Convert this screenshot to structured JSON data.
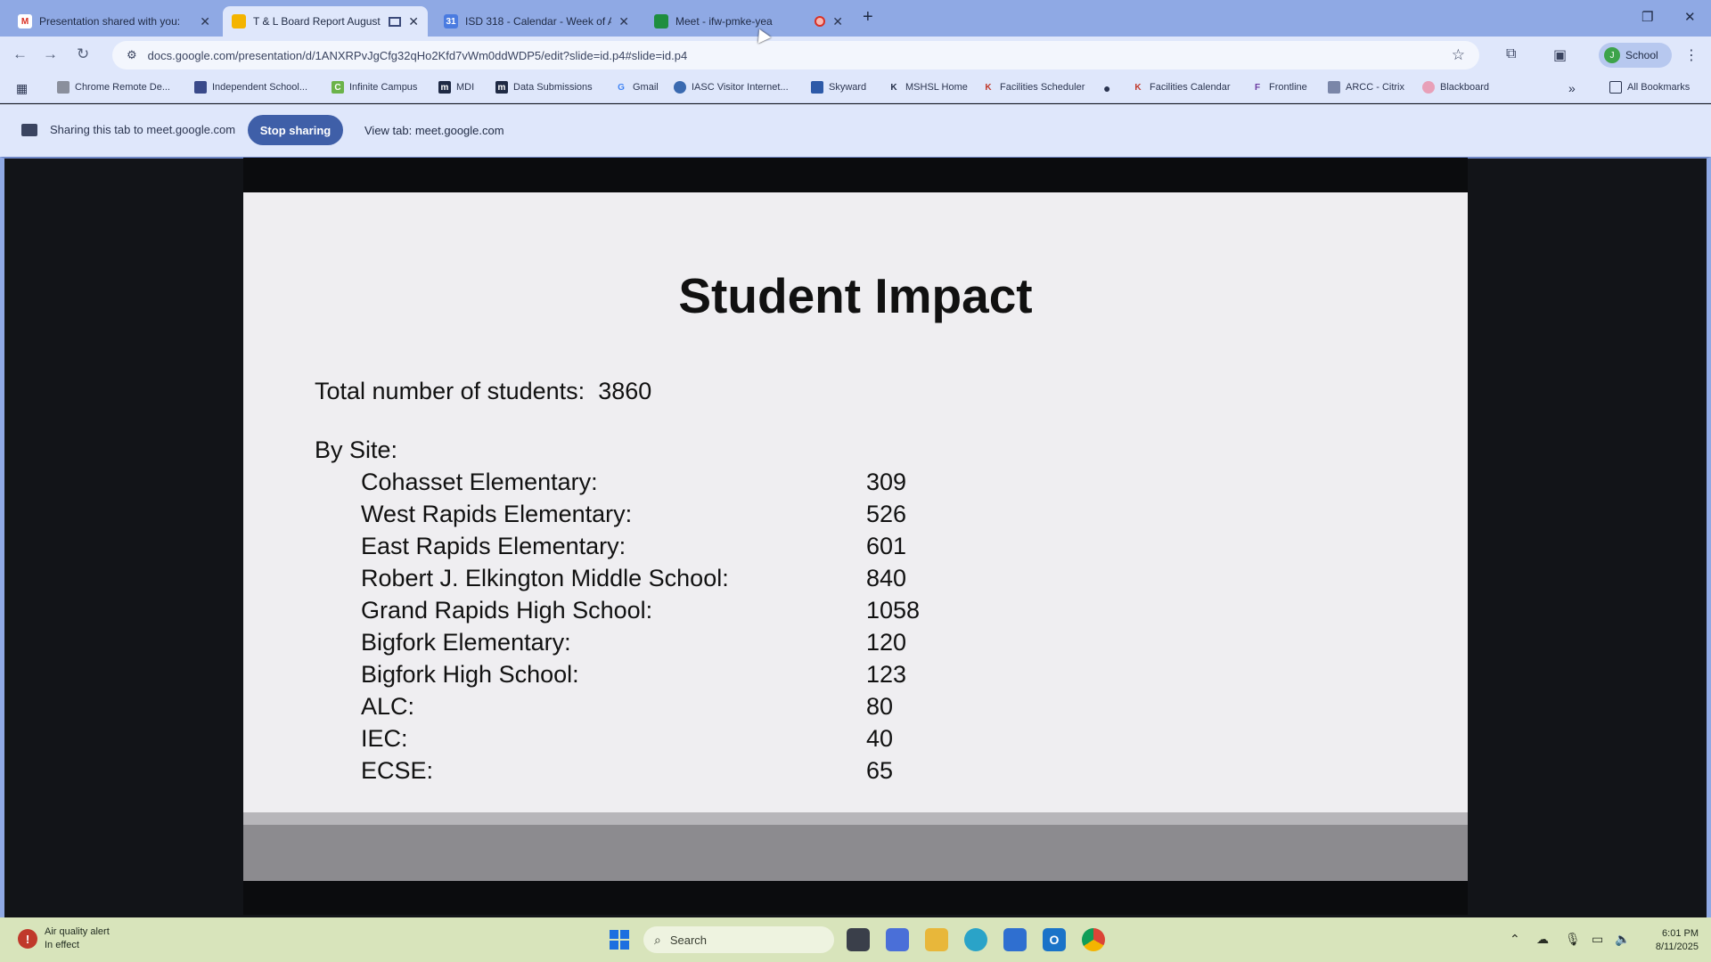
{
  "browser": {
    "tabs": [
      {
        "title": "Presentation shared with you:",
        "icon": "gmail-icon"
      },
      {
        "title": "T & L Board Report August",
        "icon": "slides-icon"
      },
      {
        "title": "ISD 318 - Calendar - Week of A",
        "icon": "calendar-icon"
      },
      {
        "title": "Meet - ifw-pmke-yea",
        "icon": "meet-icon"
      }
    ],
    "url": "docs.google.com/presentation/d/1ANXRPvJgCfg32qHo2Kfd7vWm0ddWDP5/edit?slide=id.p4#slide=id.p4",
    "profile_label": "School",
    "profile_initial": "J",
    "bookmarks": [
      "Chrome Remote De...",
      "Independent School...",
      "Infinite Campus",
      "MDI",
      "Data Submissions",
      "Gmail",
      "IASC Visitor Internet...",
      "Skyward",
      "MSHSL Home",
      "Facilities Scheduler",
      "Facilities Calendar",
      "Frontline",
      "ARCC - Citrix",
      "Blackboard"
    ],
    "all_bookmarks": "All Bookmarks",
    "overflow": "»"
  },
  "sharing": {
    "message": "Sharing this tab to meet.google.com",
    "stop_label": "Stop sharing",
    "view_label": "View tab: meet.google.com"
  },
  "slide": {
    "title": "Student Impact",
    "total_label": "Total number of students:",
    "total_value": "3860",
    "by_site_label": "By Site:",
    "sites": [
      {
        "name": "Cohasset Elementary:",
        "count": "309"
      },
      {
        "name": "West Rapids Elementary:",
        "count": "526"
      },
      {
        "name": "East Rapids Elementary:",
        "count": "601"
      },
      {
        "name": "Robert J. Elkington Middle School:",
        "count": "840"
      },
      {
        "name": "Grand Rapids High School:",
        "count": "1058"
      },
      {
        "name": "Bigfork Elementary:",
        "count": "120"
      },
      {
        "name": "Bigfork High School:",
        "count": "123"
      },
      {
        "name": "ALC:",
        "count": "80"
      },
      {
        "name": "IEC:",
        "count": "40"
      },
      {
        "name": "ECSE:",
        "count": "65"
      }
    ]
  },
  "taskbar": {
    "weather_line1": "Air quality alert",
    "weather_line2": "In effect",
    "search_placeholder": "Search",
    "time": "6:01 PM",
    "date": "8/11/2025"
  },
  "colors": {
    "tabstrip": "#8fa9e4",
    "toolbar": "#dfe7fb",
    "stop_button": "#3f5fa8",
    "slide_bg": "#efeef1",
    "taskbar": "#d8e4bb"
  }
}
